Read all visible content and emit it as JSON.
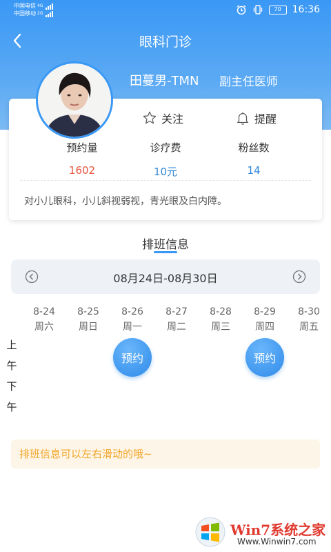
{
  "status_bar": {
    "carrier_1": "中国电信",
    "carrier_2": "中国移动",
    "net_1": "4G",
    "net_2": "2G",
    "battery": "70",
    "time": "16:36"
  },
  "nav": {
    "title": "眼科门诊"
  },
  "doctor": {
    "name": "田蔓男-TMN",
    "title": "副主任医师"
  },
  "actions": {
    "follow_label": "关注",
    "remind_label": "提醒"
  },
  "stats": [
    {
      "label": "预约量",
      "value": "1602",
      "color": "#e8563f"
    },
    {
      "label": "诊疗费",
      "value": "10元",
      "color": "#2f86d6"
    },
    {
      "label": "粉丝数",
      "value": "14",
      "color": "#2f86d6"
    }
  ],
  "intro": "对小儿眼科，小儿斜视弱视，青光眼及白内障。",
  "schedule": {
    "title": "排班信息",
    "week_range": "08月24日-08月30日",
    "days": [
      {
        "date": "8-24",
        "weekday": "周六"
      },
      {
        "date": "8-25",
        "weekday": "周日"
      },
      {
        "date": "8-26",
        "weekday": "周一"
      },
      {
        "date": "8-27",
        "weekday": "周二"
      },
      {
        "date": "8-28",
        "weekday": "周三"
      },
      {
        "date": "8-29",
        "weekday": "周四"
      },
      {
        "date": "8-30",
        "weekday": "周五"
      }
    ],
    "morning": [
      "上",
      "午"
    ],
    "afternoon": [
      "下",
      "午"
    ],
    "book_label": "预约",
    "tip": "排班信息可以左右滑动的哦~"
  },
  "watermark": {
    "brand": "Win7系统之家",
    "url": "Www.Winwin7.com"
  },
  "colors": {
    "primary": "#3a98f5",
    "tip_text": "#f2a529",
    "tip_bg": "#fdf6e8"
  }
}
